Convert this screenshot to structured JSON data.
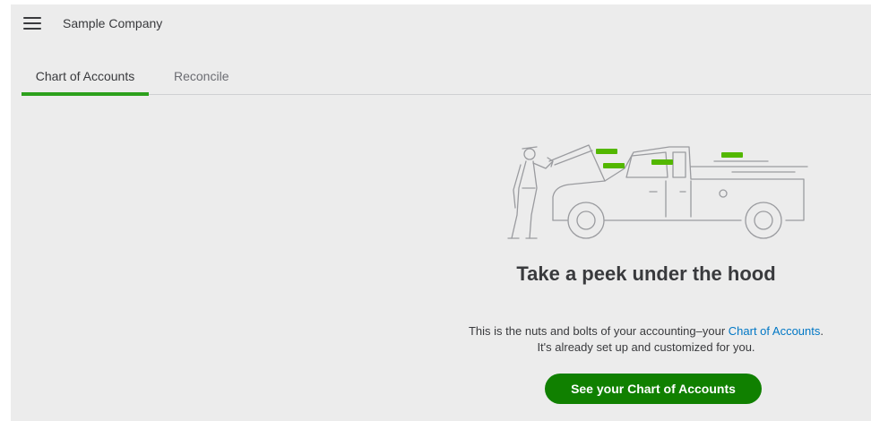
{
  "header": {
    "menu_icon": "hamburger-icon",
    "company_name": "Sample Company"
  },
  "tabs": [
    {
      "label": "Chart of Accounts",
      "active": true
    },
    {
      "label": "Reconcile",
      "active": false
    }
  ],
  "main": {
    "illustration": "mechanic-truck-illustration",
    "headline": "Take a peek under the hood",
    "description_prefix": "This is the nuts and bolts of your accounting–your ",
    "description_link": "Chart of Accounts",
    "description_suffix": ".",
    "description_line2": "It's already set up and customized for you.",
    "cta_label": "See your Chart of Accounts"
  },
  "colors": {
    "accent_green": "#2ca01c",
    "button_green": "#108000",
    "link_blue": "#0077c5",
    "text": "#393a3d",
    "background": "#ececec"
  }
}
